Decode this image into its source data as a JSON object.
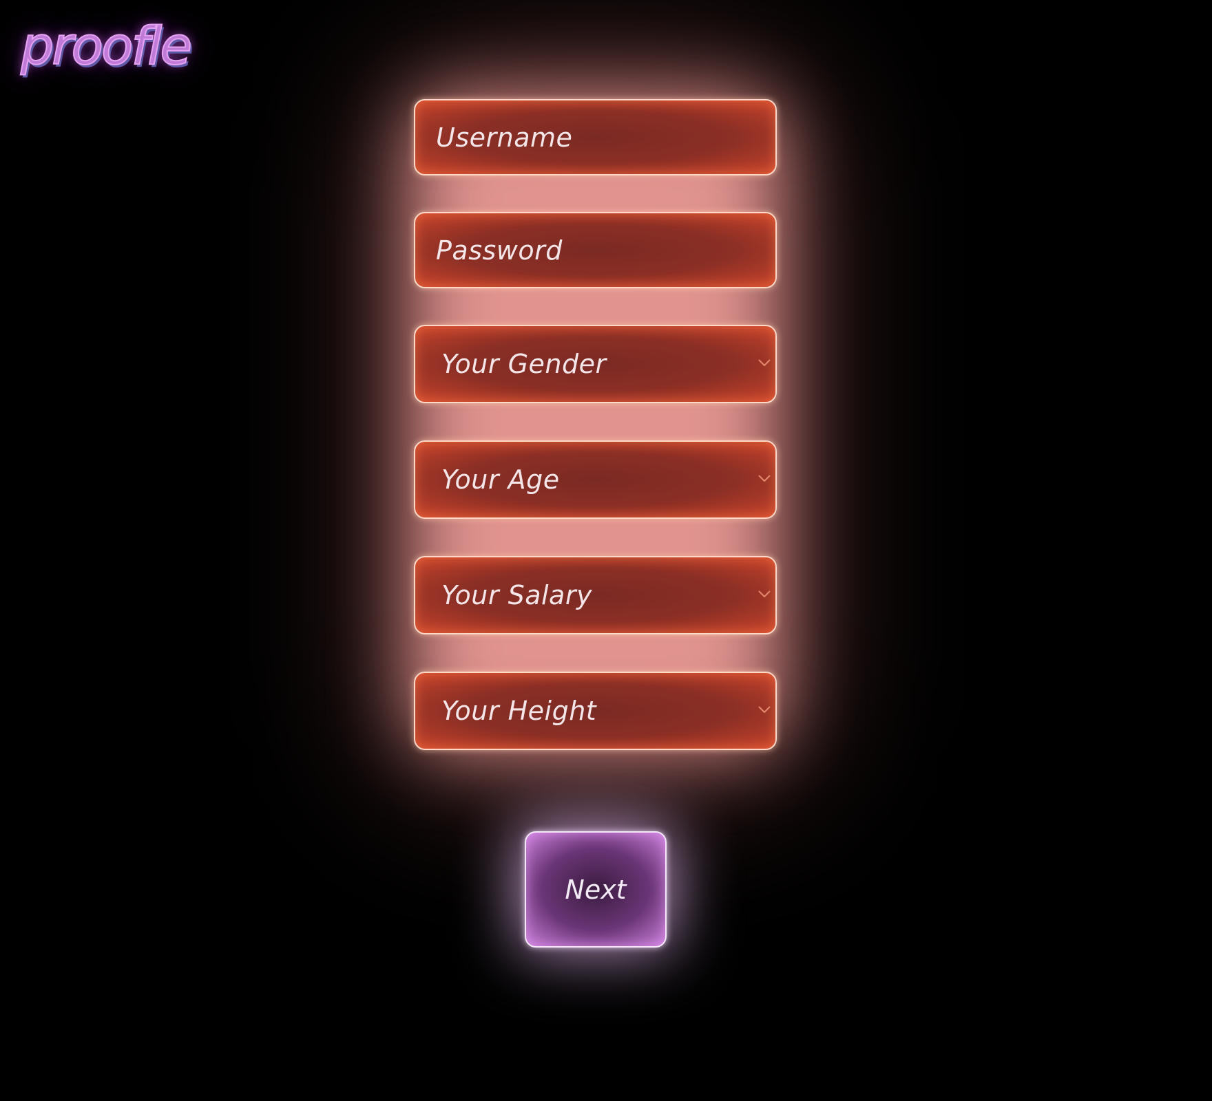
{
  "brand": {
    "logo_text": "proofle"
  },
  "form": {
    "username": {
      "placeholder": "Username"
    },
    "password": {
      "placeholder": "Password"
    },
    "gender": {
      "selected": "Your Gender"
    },
    "age": {
      "selected": "Your Age"
    },
    "salary": {
      "selected": "Your Salary"
    },
    "height": {
      "selected": "Your Height"
    },
    "next_label": "Next"
  },
  "colors": {
    "background": "#000000",
    "field_fill": "#8c2f25",
    "field_glow": "#f09e9a",
    "button_fill": "#6a3576",
    "logo": "#c07ad8"
  },
  "icons": {
    "select_arrow": "chevron-down-icon"
  }
}
